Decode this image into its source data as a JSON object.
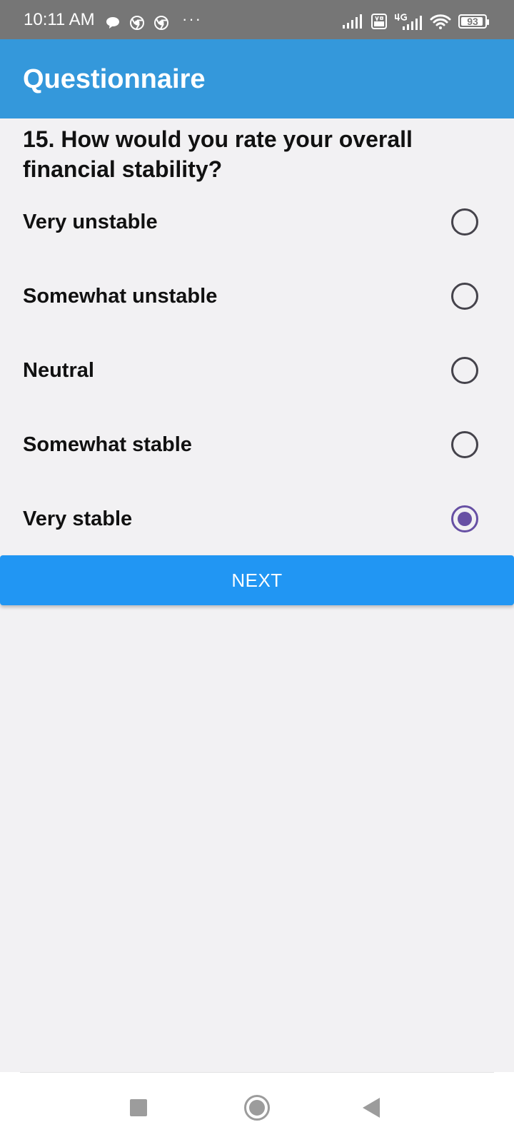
{
  "status_bar": {
    "time": "10:11 AM",
    "dots": "···",
    "battery": "93",
    "battery_level": 0.93,
    "left_icons": [
      "chat-bubble-icon",
      "chrome-icon",
      "chrome-icon"
    ],
    "right_icons": [
      "signal-icon",
      "volte-icon",
      "4g-signal-icon",
      "wifi-icon",
      "battery-icon"
    ]
  },
  "app_bar": {
    "title": "Questionnaire",
    "color": "#3498db"
  },
  "question": {
    "text": "15. How would you rate your overall financial stability?"
  },
  "options": [
    {
      "label": "Very unstable",
      "selected": false
    },
    {
      "label": "Somewhat unstable",
      "selected": false
    },
    {
      "label": "Neutral",
      "selected": false
    },
    {
      "label": "Somewhat stable",
      "selected": false
    },
    {
      "label": "Very stable",
      "selected": true
    }
  ],
  "next_button": {
    "label": "NEXT",
    "color": "#2196f3"
  },
  "nav_bar": {
    "icons": [
      "recents-square-icon",
      "home-circle-icon",
      "back-triangle-icon"
    ]
  },
  "colors": {
    "background": "#f2f1f3",
    "radio_selected": "#6750a4",
    "radio_unselected": "#45434b"
  }
}
